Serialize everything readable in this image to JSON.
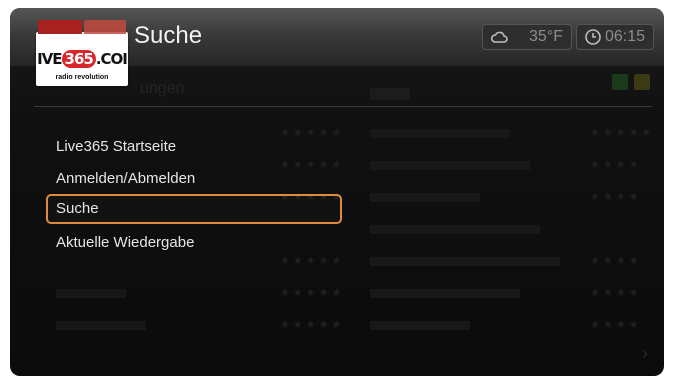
{
  "header": {
    "logo": {
      "text_prefix": "IVE",
      "text_mid": "365",
      "text_suffix": ".COI",
      "tagline": "radio revolution"
    },
    "title": "Suche",
    "weather": {
      "icon": "cloud-icon",
      "value": "35°F"
    },
    "clock": {
      "icon": "clock-icon",
      "value": "06:15"
    }
  },
  "menu": {
    "items": [
      {
        "label": "Live365 Startseite",
        "selected": false
      },
      {
        "label": "Anmelden/Abmelden",
        "selected": false
      },
      {
        "label": "Suche",
        "selected": true
      },
      {
        "label": "Aktuelle Wiedergabe",
        "selected": false
      }
    ]
  },
  "background": {
    "left_heading": "ungen"
  },
  "colors": {
    "selection_border": "#e08a3a",
    "text": "#e6e6e6",
    "background": "#0b0b0b"
  }
}
